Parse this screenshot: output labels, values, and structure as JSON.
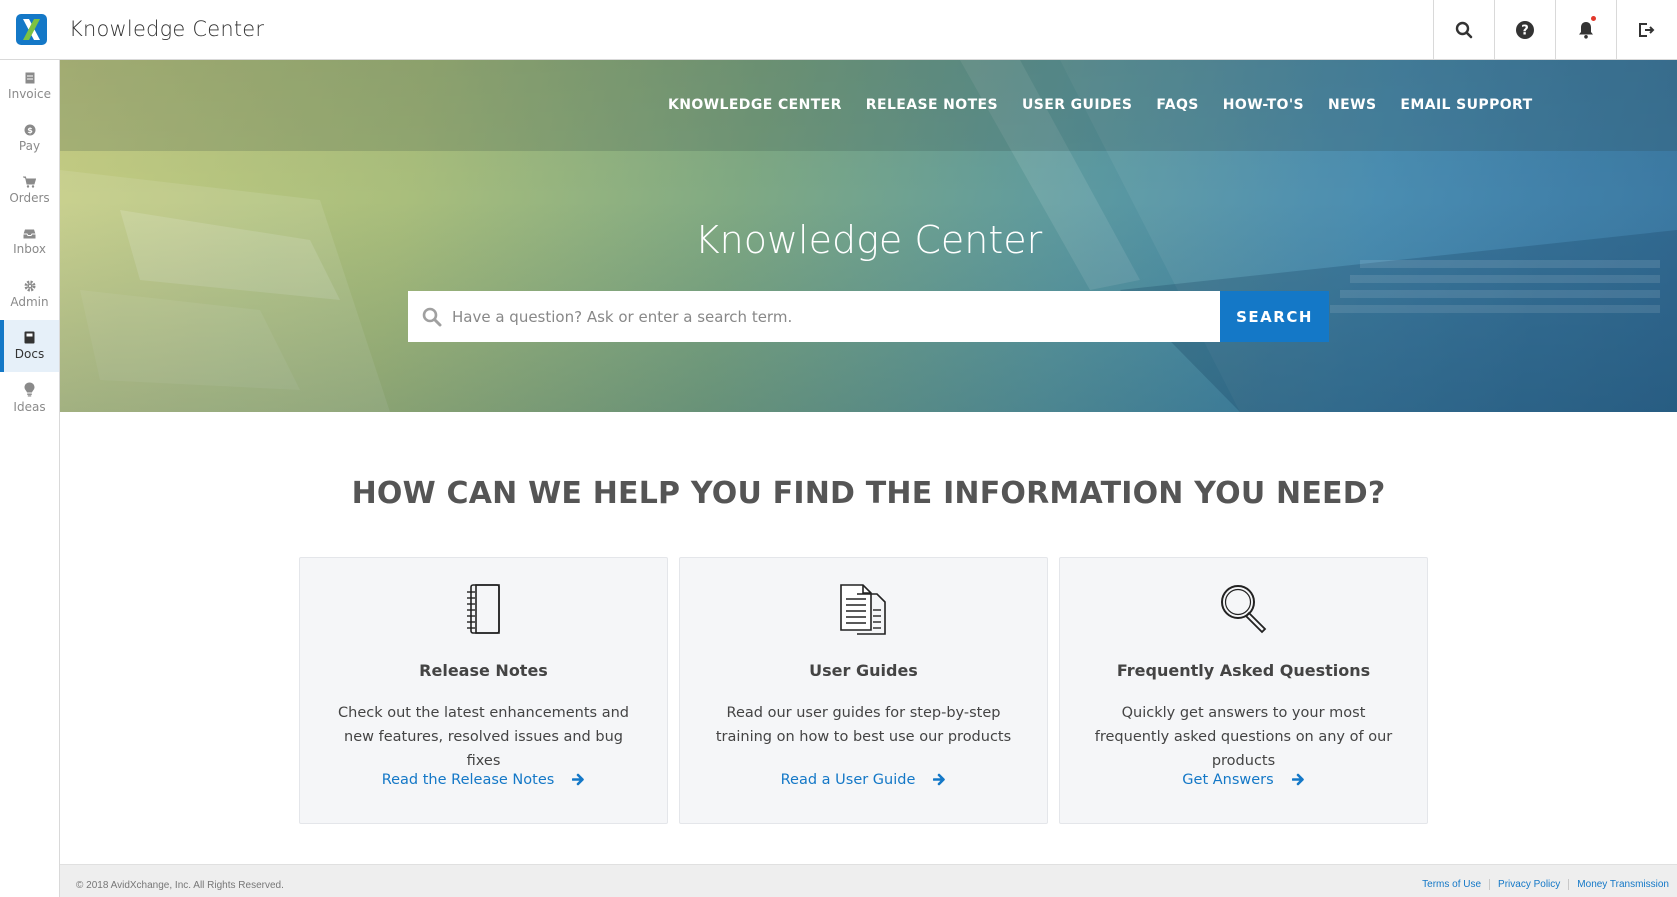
{
  "app": {
    "title": "Knowledge Center"
  },
  "topbar": {
    "actions": [
      {
        "name": "search-icon"
      },
      {
        "name": "help-icon"
      },
      {
        "name": "bell-icon"
      },
      {
        "name": "logout-icon"
      }
    ]
  },
  "sidebar": {
    "items": [
      {
        "label": "Invoice",
        "icon": "invoice-icon"
      },
      {
        "label": "Pay",
        "icon": "pay-icon"
      },
      {
        "label": "Orders",
        "icon": "cart-icon"
      },
      {
        "label": "Inbox",
        "icon": "inbox-icon"
      },
      {
        "label": "Admin",
        "icon": "gear-icon"
      },
      {
        "label": "Docs",
        "icon": "docs-icon",
        "active": true
      },
      {
        "label": "Ideas",
        "icon": "lightbulb-icon"
      }
    ]
  },
  "hero": {
    "nav": [
      "KNOWLEDGE CENTER",
      "RELEASE NOTES",
      "USER GUIDES",
      "FAQS",
      "HOW-TO'S",
      "NEWS",
      "EMAIL SUPPORT"
    ],
    "title": "Knowledge Center",
    "search_placeholder": "Have a question? Ask or enter a search term.",
    "search_button": "SEARCH"
  },
  "main": {
    "headline": "HOW CAN WE HELP YOU FIND THE INFORMATION YOU NEED?",
    "cards": [
      {
        "icon": "notebook-icon",
        "title": "Release Notes",
        "description": "Check out the latest enhancements and new features, resolved issues and bug fixes",
        "link": "Read the Release Notes"
      },
      {
        "icon": "documents-icon",
        "title": "User Guides",
        "description": "Read our user guides for step-by-step training on how to best use our products",
        "link": "Read a User Guide"
      },
      {
        "icon": "magnifier-icon",
        "title": "Frequently Asked Questions",
        "description": "Quickly get answers to your most frequently asked questions on any of our products",
        "link": "Get Answers"
      }
    ]
  },
  "footer": {
    "copyright": "© 2018 AvidXchange, Inc. All Rights Reserved.",
    "links": [
      "Terms of Use",
      "Privacy Policy",
      "Money Transmission"
    ]
  },
  "colors": {
    "brand_blue": "#1478c7",
    "notification_dot": "#e2382b"
  }
}
